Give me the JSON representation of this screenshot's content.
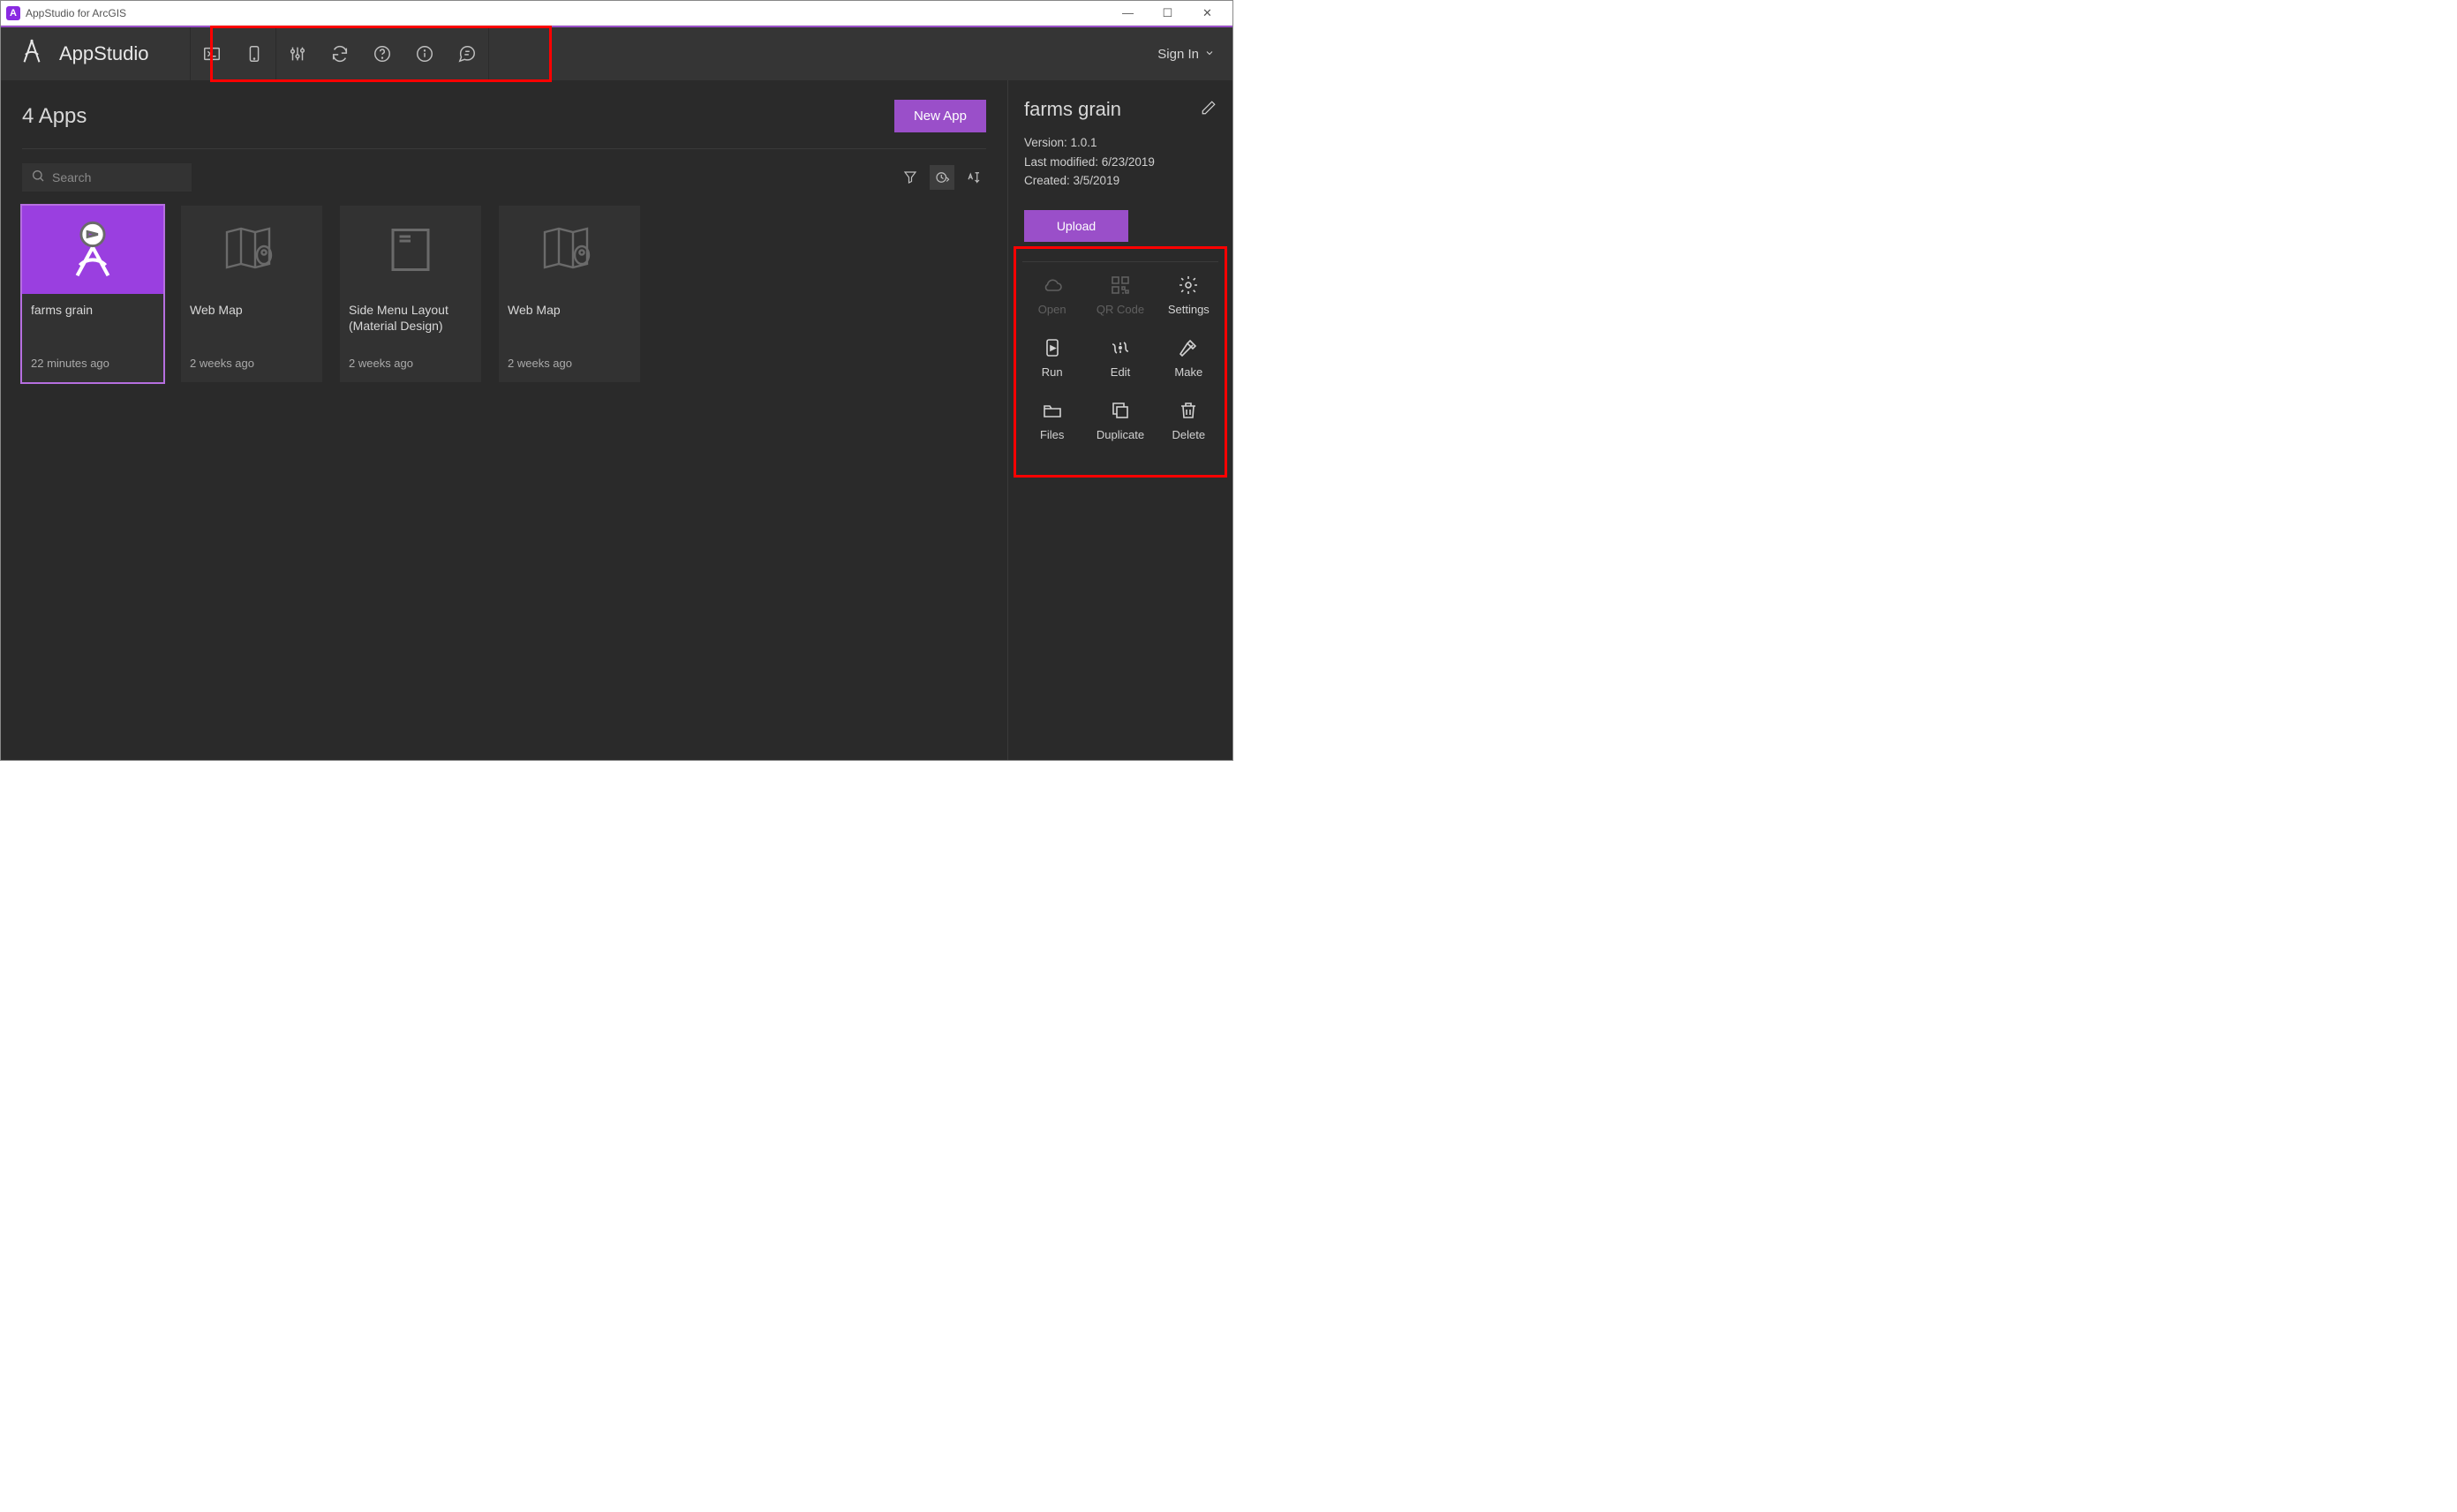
{
  "window": {
    "title": "AppStudio for ArcGIS",
    "app_initial": "A"
  },
  "header": {
    "brand": "AppStudio",
    "signin": "Sign In"
  },
  "main": {
    "count_label": "4 Apps",
    "new_app": "New App",
    "search_placeholder": "Search"
  },
  "cards": [
    {
      "title": "farms grain",
      "time": "22 minutes ago",
      "selected": true,
      "kind": "app"
    },
    {
      "title": "Web Map",
      "time": "2 weeks ago",
      "selected": false,
      "kind": "map"
    },
    {
      "title": "Side Menu Layout (Material Design)",
      "time": "2 weeks ago",
      "selected": false,
      "kind": "layout"
    },
    {
      "title": "Web Map",
      "time": "2 weeks ago",
      "selected": false,
      "kind": "map"
    }
  ],
  "side": {
    "title": "farms grain",
    "version": "Version: 1.0.1",
    "modified": "Last modified: 6/23/2019",
    "created": "Created: 3/5/2019",
    "upload": "Upload",
    "actions": {
      "open": "Open",
      "qr": "QR Code",
      "settings": "Settings",
      "run": "Run",
      "edit": "Edit",
      "make": "Make",
      "files": "Files",
      "duplicate": "Duplicate",
      "delete": "Delete"
    }
  }
}
